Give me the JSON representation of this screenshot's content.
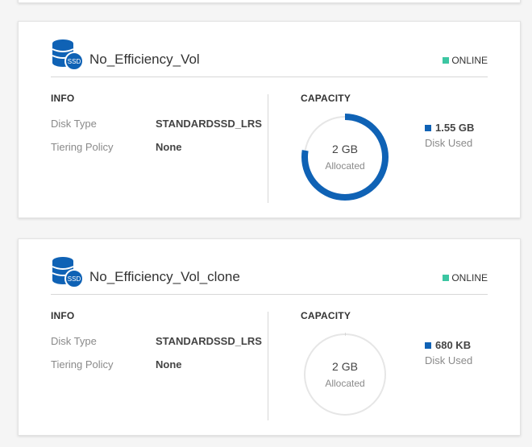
{
  "volumes": [
    {
      "name": "No_Efficiency_Vol",
      "status": "ONLINE",
      "icon_badge": "SSD",
      "info_title": "INFO",
      "disk_type_label": "Disk Type",
      "disk_type_value": "STANDARDSSD_LRS",
      "tiering_label": "Tiering Policy",
      "tiering_value": "None",
      "capacity_title": "CAPACITY",
      "allocated_size": "2 GB",
      "allocated_label": "Allocated",
      "used_value": "1.55 GB",
      "used_label": "Disk Used",
      "used_fraction": 0.775
    },
    {
      "name": "No_Efficiency_Vol_clone",
      "status": "ONLINE",
      "icon_badge": "SSD",
      "info_title": "INFO",
      "disk_type_label": "Disk Type",
      "disk_type_value": "STANDARDSSD_LRS",
      "tiering_label": "Tiering Policy",
      "tiering_value": "None",
      "capacity_title": "CAPACITY",
      "allocated_size": "2 GB",
      "allocated_label": "Allocated",
      "used_value": "680 KB",
      "used_label": "Disk Used",
      "used_fraction": 0.0003
    }
  ],
  "colors": {
    "accent": "#0f62b5",
    "online": "#3cc6a2",
    "track": "#e6e6e6"
  }
}
